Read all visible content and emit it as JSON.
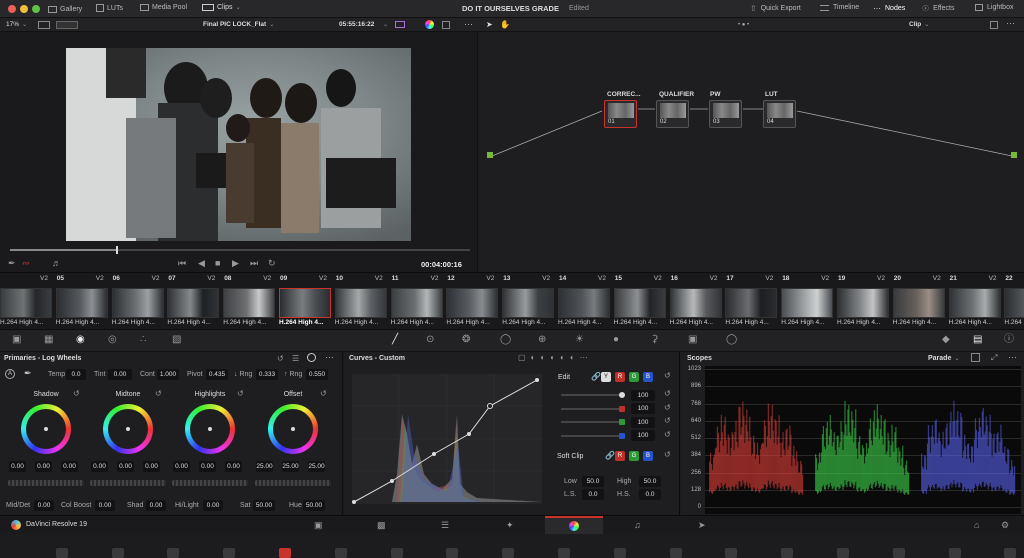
{
  "topbar": {
    "gallery": "Gallery",
    "luts": "LUTs",
    "media_pool": "Media Pool",
    "clips": "Clips",
    "project_title": "DO IT OURSELVES GRADE",
    "project_status": "Edited",
    "quick_export": "Quick Export",
    "timeline": "Timeline",
    "nodes": "Nodes",
    "effects": "Effects",
    "lightbox": "Lightbox"
  },
  "viewer": {
    "zoom": "17%",
    "timeline_name": "Final PIC LOCK_Flat",
    "timecode_top": "05:55:16:22",
    "timecode_bottom": "00:04:00:16",
    "playhead_fraction": 0.23
  },
  "node_panel": {
    "mode": "Clip",
    "nodes": [
      {
        "label": "CORREC...",
        "num": "01"
      },
      {
        "label": "QUALIFIER",
        "num": "02"
      },
      {
        "label": "PW",
        "num": "03"
      },
      {
        "label": "LUT",
        "num": "04"
      }
    ]
  },
  "timeline_strip": {
    "clips": [
      {
        "num": "",
        "track": "V2",
        "codec": "H.264 High 4..."
      },
      {
        "num": "05",
        "track": "V2",
        "codec": "H.264 High 4..."
      },
      {
        "num": "06",
        "track": "V2",
        "codec": "H.264 High 4..."
      },
      {
        "num": "07",
        "track": "V2",
        "codec": "H.264 High 4..."
      },
      {
        "num": "08",
        "track": "V2",
        "codec": "H.264 High 4..."
      },
      {
        "num": "09",
        "track": "V2",
        "codec": "H.264 High 4..."
      },
      {
        "num": "10",
        "track": "V2",
        "codec": "H.264 High 4..."
      },
      {
        "num": "11",
        "track": "V2",
        "codec": "H.264 High 4..."
      },
      {
        "num": "12",
        "track": "V2",
        "codec": "H.264 High 4..."
      },
      {
        "num": "13",
        "track": "V2",
        "codec": "H.264 High 4..."
      },
      {
        "num": "14",
        "track": "V2",
        "codec": "H.264 High 4..."
      },
      {
        "num": "15",
        "track": "V2",
        "codec": "H.264 High 4..."
      },
      {
        "num": "16",
        "track": "V2",
        "codec": "H.264 High 4..."
      },
      {
        "num": "17",
        "track": "V2",
        "codec": "H.264 High 4..."
      },
      {
        "num": "18",
        "track": "V2",
        "codec": "H.264 High 4..."
      },
      {
        "num": "19",
        "track": "V2",
        "codec": "H.264 High 4..."
      },
      {
        "num": "20",
        "track": "V2",
        "codec": "H.264 High 4..."
      },
      {
        "num": "21",
        "track": "V2",
        "codec": "H.264 High 4..."
      },
      {
        "num": "22",
        "track": "V2",
        "codec": "H.264 High 4..."
      }
    ]
  },
  "primaries": {
    "title": "Primaries - Log Wheels",
    "temp_label": "Temp",
    "temp": "0.0",
    "tint_label": "Tint",
    "tint": "0.00",
    "cont_label": "Cont",
    "cont": "1.000",
    "pivot_label": "Pivot",
    "pivot": "0.435",
    "rng_low_label": "↓ Rng",
    "rng_low": "0.333",
    "rng_high_label": "↑ Rng",
    "rng_high": "0.550",
    "wheels": [
      {
        "name": "Shadow",
        "values": [
          "0.00",
          "0.00",
          "0.00"
        ]
      },
      {
        "name": "Midtone",
        "values": [
          "0.00",
          "0.00",
          "0.00"
        ]
      },
      {
        "name": "Highlights",
        "values": [
          "0.00",
          "0.00",
          "0.00"
        ]
      },
      {
        "name": "Offset",
        "values": [
          "25.00",
          "25.00",
          "25.00"
        ]
      }
    ],
    "middet_label": "Mid/Det",
    "middet": "0.00",
    "colboost_label": "Col Boost",
    "colboost": "0.00",
    "shad_label": "Shad",
    "shad": "0.00",
    "hilight_label": "Hi/Light",
    "hilight": "0.00",
    "sat_label": "Sat",
    "sat": "50.00",
    "hue_label": "Hue",
    "hue": "50.00"
  },
  "curves": {
    "title": "Curves - Custom",
    "edit_label": "Edit",
    "channels": [
      "Y",
      "R",
      "G",
      "B"
    ],
    "intensity": [
      "100",
      "100",
      "100",
      "100"
    ],
    "soft_clip_label": "Soft Clip",
    "low_label": "Low",
    "low": "50.0",
    "high_label": "High",
    "high": "50.0",
    "ls_label": "L.S.",
    "ls": "0.0",
    "hs_label": "H.S.",
    "hs": "0.0"
  },
  "scopes": {
    "title": "Scopes",
    "mode": "Parade",
    "scale": [
      "1023",
      "896",
      "768",
      "640",
      "512",
      "384",
      "256",
      "128",
      "0"
    ]
  },
  "bottombar": {
    "app_name": "DaVinci Resolve 19"
  },
  "colors": {
    "accent_red": "#c8342c",
    "node_link_green": "#7ab83a",
    "node_link_blue": "#2e9bdb"
  }
}
